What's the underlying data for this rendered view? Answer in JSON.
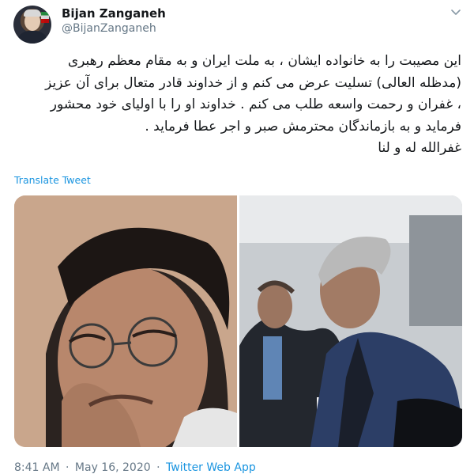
{
  "author": {
    "name": "Bijan Zanganeh",
    "handle": "@BijanZanganeh"
  },
  "tweet": {
    "lines": [
      "این مصیبت را به خانواده ایشان ، به ملت ایران و به مقام معظم رهبری",
      "(مدظله العالی) تسلیت عرض می کنم و از خداوند قادر متعال برای آن عزیز",
      "، غفران و رحمت واسعه طلب می کنم . خداوند او را با اولیای خود محشور",
      "فرماید و به بازماندگان محترمش صبر و اجر عطا فرماید .",
      "غفرالله له و لنا"
    ],
    "translate_label": "Translate Tweet"
  },
  "meta": {
    "time": "8:41 AM",
    "separator": "·",
    "date": "May 16, 2020",
    "app": "Twitter Web App"
  },
  "icons": {
    "caret": "chevron-down-icon"
  },
  "colors": {
    "link": "#1b95e0",
    "secondary_text": "#657786",
    "primary_text": "#14171a"
  }
}
